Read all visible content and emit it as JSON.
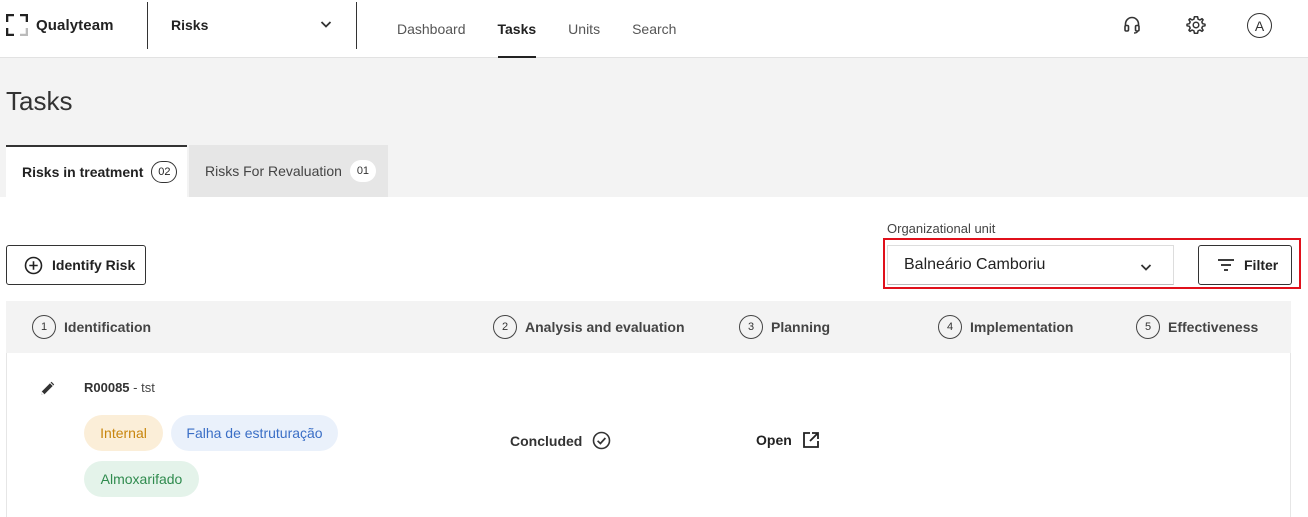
{
  "app": {
    "brand": "Qualyteam",
    "module": "Risks"
  },
  "nav": [
    {
      "label": "Dashboard",
      "active": false
    },
    {
      "label": "Tasks",
      "active": true
    },
    {
      "label": "Units",
      "active": false
    },
    {
      "label": "Search",
      "active": false
    }
  ],
  "header_icons": {
    "support": "headset-icon",
    "settings": "gear-icon",
    "avatar_letter": "A"
  },
  "page": {
    "title": "Tasks"
  },
  "tabs": [
    {
      "label": "Risks in treatment",
      "count": "02",
      "active": true
    },
    {
      "label": "Risks For Revaluation",
      "count": "01",
      "active": false
    }
  ],
  "actions": {
    "identify_label": "Identify Risk",
    "org_unit_label": "Organizational unit",
    "org_unit_value": "Balneário Camboriu",
    "filter_label": "Filter"
  },
  "steps": [
    {
      "num": "1",
      "label": "Identification"
    },
    {
      "num": "2",
      "label": "Analysis and evaluation"
    },
    {
      "num": "3",
      "label": "Planning"
    },
    {
      "num": "4",
      "label": "Implementation"
    },
    {
      "num": "5",
      "label": "Effectiveness"
    }
  ],
  "risk": {
    "code": "R00085",
    "separator": " - ",
    "name": "tst",
    "tags": [
      {
        "label": "Internal",
        "color": "#c8860e"
      },
      {
        "label": "Falha de estruturação",
        "color": "#3b6fc6"
      },
      {
        "label": "Almoxarifado",
        "color": "#2f8b4e"
      }
    ],
    "analysis_status": "Concluded",
    "planning_status": "Open"
  },
  "colors": {
    "highlight": "#e0101b",
    "header_bg": "#f3f3f3"
  }
}
